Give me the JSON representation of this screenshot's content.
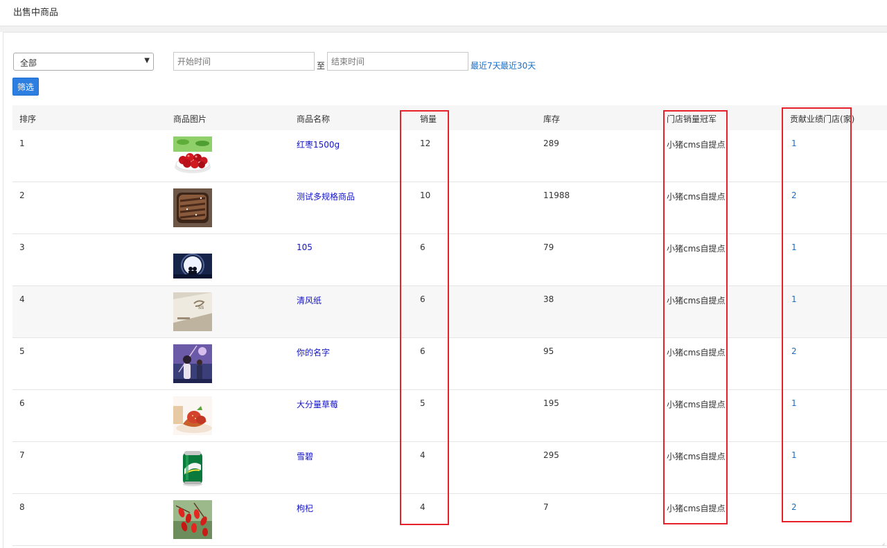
{
  "page": {
    "title": "出售中商品"
  },
  "filters": {
    "store_select_value": "全部",
    "start_placeholder": "开始时间",
    "to_label": "至",
    "end_placeholder": "结束时间",
    "quick_7": "最近7天",
    "quick_30": "最近30天",
    "filter_button": "筛选"
  },
  "table": {
    "headers": [
      "排序",
      "商品图片",
      "商品名称",
      "销量",
      "库存",
      "门店销量冠军",
      "贡献业绩门店(家)"
    ],
    "rows": [
      {
        "rank": "1",
        "name": "红枣1500g",
        "sales": "12",
        "stock": "289",
        "champion": "小猪cms自提点",
        "stores": "1",
        "image_icon": "red-dates-photo"
      },
      {
        "rank": "2",
        "name": "测试多规格商品",
        "sales": "10",
        "stock": "11988",
        "champion": "小猪cms自提点",
        "stores": "2",
        "image_icon": "grilled-steak-photo"
      },
      {
        "rank": "3",
        "name": "105",
        "sales": "6",
        "stock": "79",
        "champion": "小猪cms自提点",
        "stores": "1",
        "image_icon": "moonlight-silhouette-photo"
      },
      {
        "rank": "4",
        "name": "清风纸",
        "sales": "6",
        "stock": "38",
        "champion": "小猪cms自提点",
        "stores": "1",
        "image_icon": "tissue-package-photo"
      },
      {
        "rank": "5",
        "name": "你的名字",
        "sales": "6",
        "stock": "95",
        "champion": "小猪cms自提点",
        "stores": "2",
        "image_icon": "anime-poster-photo"
      },
      {
        "rank": "6",
        "name": "大分量草莓",
        "sales": "5",
        "stock": "195",
        "champion": "小猪cms自提点",
        "stores": "1",
        "image_icon": "strawberry-cake-photo"
      },
      {
        "rank": "7",
        "name": "雪碧",
        "sales": "4",
        "stock": "295",
        "champion": "小猪cms自提点",
        "stores": "1",
        "image_icon": "sprite-can-photo"
      },
      {
        "rank": "8",
        "name": "枸杞",
        "sales": "4",
        "stock": "7",
        "champion": "小猪cms自提点",
        "stores": "2",
        "image_icon": "goji-berries-photo"
      }
    ]
  },
  "colors": {
    "accent": "#2c7fe0",
    "link": "#1212c9",
    "highlight_box": "#e8202a"
  }
}
